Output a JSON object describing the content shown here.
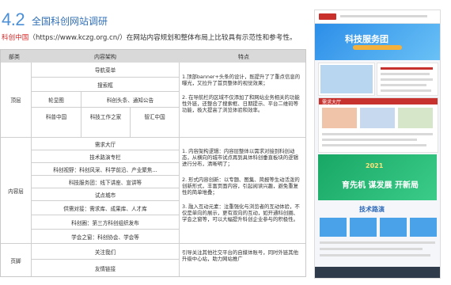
{
  "header": {
    "number": "4.2",
    "title": "全国科创网站调研",
    "subtitle_highlight": "科创中国",
    "subtitle_rest": "（https://www.kczg.org.cn/）在网站内容规划和整体布局上比较具有示范性和参考性。"
  },
  "table": {
    "columns": [
      "部类",
      "内容架构",
      "特点"
    ],
    "top": {
      "section": "顶层",
      "rows": [
        "导航菜单",
        "搜索框"
      ],
      "grid": [
        [
          "轮显图",
          "科创头条、通知公告"
        ],
        [
          "科普中国",
          "科技工作之家",
          "智汇中国"
        ]
      ],
      "features": [
        "1.顶部banner+头条的设计，既提升了了重点信息的曝光，又拉升了首页整体的视觉效果；",
        "2. 在导航栏的区域不仅添加了和网站业务相关的功能性外链，还整合了搜索框、日期提示、平台二维码等功能，极大提高了浏览体验和效率。"
      ]
    },
    "middle": {
      "section": "内容层",
      "rows": [
        "需求大厅",
        "技术路演专栏",
        "科创视野：科创风采、科学前沿、产业聚焦...",
        "科技服务团：线下讲座、宣讲等",
        "试点城市",
        "供需对接：需求库、成果库、人才库",
        "科创圈：第三方科创组织发布",
        "学会之窗：科创协会、学会等"
      ],
      "features": [
        "1. 内容架构逻辑：内容层整体以需求对接到科创动态，从横向的城市试点再到具体科创垂直板块的逻辑进行分布，清晰明了；",
        "2. 形式内容创新：以专题、图集、简报等生动活泼的创新形式，丰富页面内容，引起阅读兴趣，避免重复性的简单堆叠；",
        "3. 融入互动元素：注重强化与浏览者的互动体验，不仅是单向的展示，更有双向的互动，如开通科创圈、学会之窗等，可以大幅提升科创企业参与的积极性。"
      ]
    },
    "bottom": {
      "section": "页脚",
      "rows": [
        "关注我们",
        "友情链接"
      ],
      "features": [
        "引导关注其他社交平台的自媒体账号，同时外链其他升级中心站，助力网站推广"
      ]
    }
  },
  "screenshot": {
    "banner_title": "科技服务团",
    "list_heading": "需求大厅",
    "green_banner_title": "育先机 谋发展 开新局",
    "green_banner_year": "2021",
    "roadshow_title": "技术路演"
  },
  "colors": {
    "accent": "#4a8fd8",
    "highlight": "#d62828",
    "header_bg": "#d9d9d9"
  }
}
